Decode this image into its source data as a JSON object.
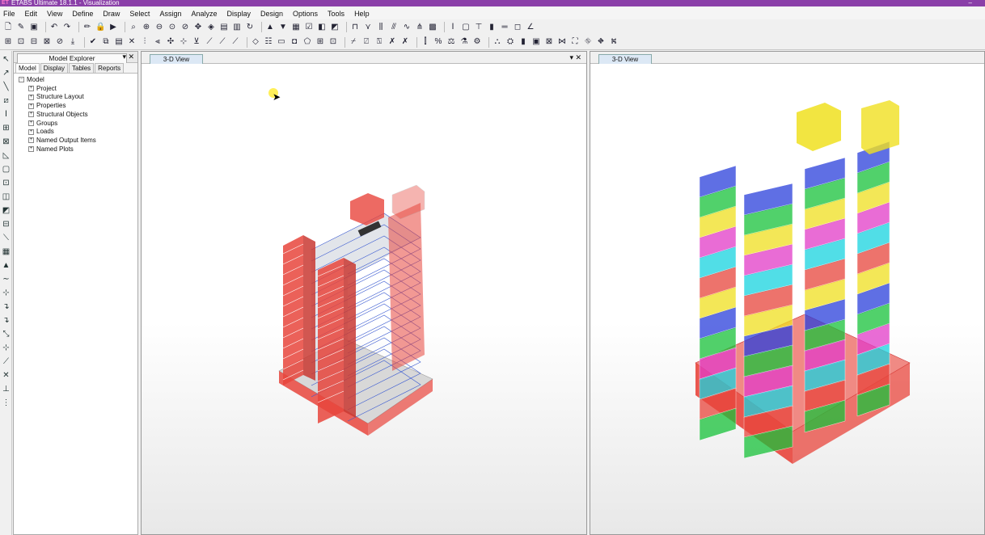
{
  "window": {
    "title": "ETABS Ultimate 18.1.1 - Visualization",
    "logo": "ET"
  },
  "menu": [
    "File",
    "Edit",
    "View",
    "Define",
    "Draw",
    "Select",
    "Assign",
    "Analyze",
    "Display",
    "Design",
    "Options",
    "Tools",
    "Help"
  ],
  "explorer": {
    "title": "Model Explorer",
    "tabs": [
      "Model",
      "Display",
      "Tables",
      "Reports"
    ],
    "active_tab": "Model",
    "root": "Model",
    "children": [
      "Project",
      "Structure Layout",
      "Properties",
      "Structural Objects",
      "Groups",
      "Loads",
      "Named Output Items",
      "Named Plots"
    ]
  },
  "views": [
    {
      "tab": "3-D View",
      "controls": "▾ ✕"
    },
    {
      "tab": "3-D View"
    }
  ],
  "colors": {
    "titlebar": "#8a3fa8",
    "wall_red": "#e8453c",
    "frame_blue": "#3b5bd1",
    "story_colors": [
      "#e8453c",
      "#2a3fdc",
      "#18c23a",
      "#f0e020",
      "#e23cc8",
      "#18d4e0"
    ]
  }
}
